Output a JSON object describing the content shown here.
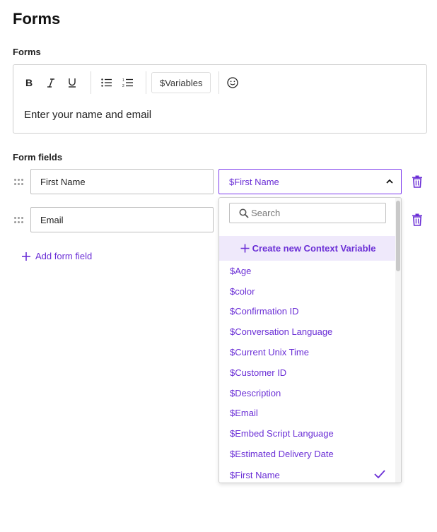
{
  "page": {
    "title": "Forms"
  },
  "editor_section": {
    "label": "Forms",
    "toolbar": {
      "bold": "B",
      "variables_label": "$Variables"
    },
    "content": "Enter your name and email"
  },
  "form_fields": {
    "label": "Form fields",
    "rows": [
      {
        "name": "First Name",
        "variable": "$First Name"
      },
      {
        "name": "Email"
      }
    ],
    "add_label": "Add form field"
  },
  "dropdown": {
    "search_placeholder": "Search",
    "create_label": "Create new Context Variable",
    "items": [
      "$Age",
      "$color",
      "$Confirmation ID",
      "$Conversation Language",
      "$Current Unix Time",
      "$Customer ID",
      "$Description",
      "$Email",
      "$Embed Script Language",
      "$Estimated Delivery Date",
      "$First Name"
    ],
    "selected": "$First Name"
  },
  "colors": {
    "accent": "#6b2fd6",
    "accent_border": "#7c3aed",
    "highlight_bg": "#efe9fb",
    "trash": "#6b2fd6"
  }
}
